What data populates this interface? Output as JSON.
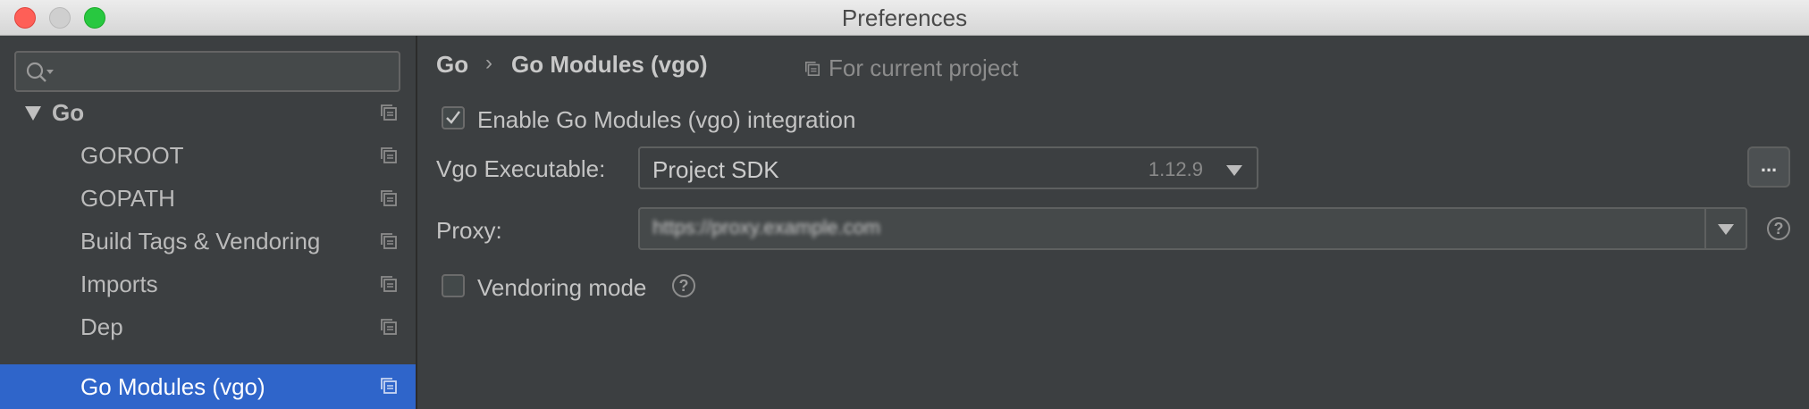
{
  "window": {
    "title": "Preferences"
  },
  "sidebar": {
    "search": {
      "value": "",
      "placeholder": ""
    },
    "items": [
      {
        "label": "Go",
        "level": 0,
        "expanded": true,
        "selected": false
      },
      {
        "label": "GOROOT",
        "level": 1,
        "selected": false
      },
      {
        "label": "GOPATH",
        "level": 1,
        "selected": false
      },
      {
        "label": "Build Tags & Vendoring",
        "level": 1,
        "selected": false
      },
      {
        "label": "Imports",
        "level": 1,
        "selected": false
      },
      {
        "label": "Dep",
        "level": 1,
        "selected": false
      },
      {
        "label": "Go Modules (vgo)",
        "level": 1,
        "selected": true
      }
    ]
  },
  "main": {
    "breadcrumb": {
      "parent": "Go",
      "separator": "›",
      "current": "Go Modules (vgo)"
    },
    "scope_label": "For current project",
    "enable_integration": {
      "label": "Enable Go Modules (vgo) integration",
      "checked": true
    },
    "executable": {
      "label": "Vgo Executable:",
      "value": "Project SDK",
      "version": "1.12.9",
      "browse_label": "..."
    },
    "proxy": {
      "label": "Proxy:",
      "value": "https://proxy.example.com"
    },
    "vendoring": {
      "label": "Vendoring mode",
      "checked": false
    },
    "help_glyph": "?"
  },
  "colors": {
    "background": "#3c3f41",
    "selection": "#2f65ca",
    "text": "#bbbbbb"
  }
}
